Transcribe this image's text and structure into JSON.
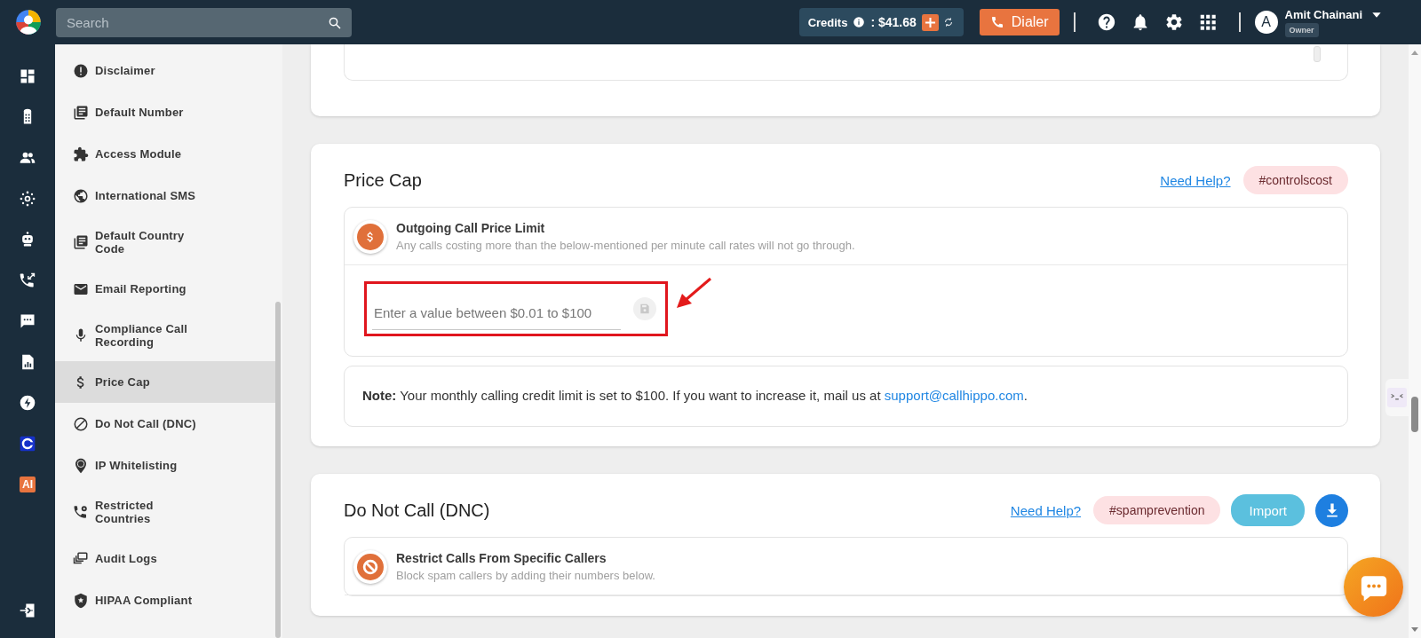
{
  "topbar": {
    "search": {
      "placeholder": "Search"
    },
    "credits": {
      "label": "Credits",
      "amount": ": $41.68"
    },
    "dialer_button": "Dialer",
    "user": {
      "initial": "A",
      "name": "Amit Chainani",
      "role": "Owner"
    }
  },
  "rail": {
    "ai_badge": "AI"
  },
  "settings_menu": {
    "items": [
      {
        "label": "Disclaimer",
        "selected": false
      },
      {
        "label": "Default Number",
        "selected": false
      },
      {
        "label": "Access Module",
        "selected": false
      },
      {
        "label": "International SMS",
        "selected": false
      },
      {
        "label": "Default Country Code",
        "selected": false
      },
      {
        "label": "Email Reporting",
        "selected": false
      },
      {
        "label": "Compliance Call Recording",
        "selected": false
      },
      {
        "label": "Price Cap",
        "selected": true
      },
      {
        "label": "Do Not Call (DNC)",
        "selected": false
      },
      {
        "label": "IP Whitelisting",
        "selected": false
      },
      {
        "label": "Restricted Countries",
        "selected": false
      },
      {
        "label": "Audit Logs",
        "selected": false
      },
      {
        "label": "HIPAA Compliant",
        "selected": false
      }
    ]
  },
  "sections": [
    {
      "kind": "price",
      "title": "Price Cap",
      "help_link": "Need Help?",
      "tag": "#controlscost",
      "setting": {
        "title": "Outgoing Call Price Limit",
        "description": "Any calls costing more than the below-mentioned per minute call rates will not go through."
      },
      "field": {
        "placeholder": "Enter a value between $0.01 to $100"
      },
      "note": {
        "text": "**Note:** Your monthly calling credit limit is set to $100. If you want to increase it, mail us at ",
        "link": "support@callhippo.com",
        "end": "."
      }
    },
    {
      "kind": "block",
      "title": "Do Not Call (DNC)",
      "help_link": "Need Help?",
      "tag": "#spamprevention",
      "import_button": "Import",
      "setting": {
        "title": "Restrict Calls From Specific Callers",
        "description": "Block spam callers by adding their numbers below."
      }
    }
  ]
}
